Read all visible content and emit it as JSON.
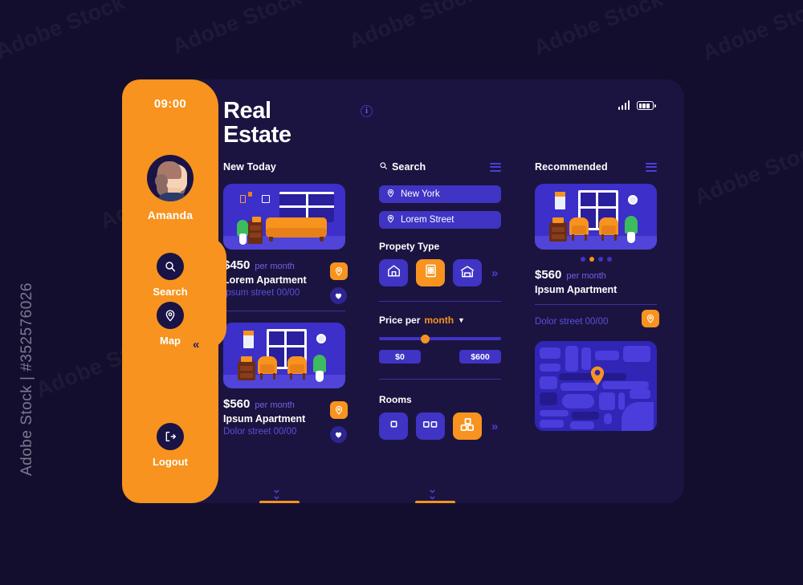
{
  "watermark": {
    "tiles": [
      "Adobe Stock",
      "Adobe Stock",
      "Adobe Stock",
      "Adobe Stock",
      "Adobe Stock",
      "Adobe Stock",
      "Adobe Stock",
      "Adobe Stock",
      "Adobe Stock",
      "Adobe Stock",
      "Adobe Stock",
      "Adobe Stock"
    ],
    "credit": "Adobe Stock | #352576026"
  },
  "colors": {
    "background": "#130e2e",
    "panel": "#1b1440",
    "accent_orange": "#f7931e",
    "accent_blue": "#3f34c4",
    "muted_blue": "#5b4fdd",
    "text": "#ffffff"
  },
  "sidebar": {
    "time": "09:00",
    "user_name": "Amanda",
    "items": [
      {
        "label": "Search",
        "icon": "search-icon"
      },
      {
        "label": "Map",
        "icon": "map-pin-icon"
      },
      {
        "label": "Logout",
        "icon": "logout-icon"
      }
    ],
    "collapse_icon": "«"
  },
  "header": {
    "title_line1": "Real",
    "title_line2": "Estate",
    "info_icon": "i",
    "signal_icon": "signal-bars-icon",
    "battery_icon": "battery-icon"
  },
  "new_today": {
    "heading": "New Today",
    "listings": [
      {
        "price": "$450",
        "period": "per month",
        "name": "Lorem Apartment",
        "address": "Ipsum street 00/00",
        "pin_icon": "map-pin-icon",
        "favorite_icon": "heart-icon",
        "illustration": "living-room-sofa"
      },
      {
        "price": "$560",
        "period": "per month",
        "name": "Ipsum Apartment",
        "address": "Dolor street 00/00",
        "pin_icon": "map-pin-icon",
        "favorite_icon": "heart-icon",
        "illustration": "living-room-armchairs"
      }
    ],
    "scroll_icon": "chevron-double-down-icon"
  },
  "search": {
    "heading": "Search",
    "search_icon": "search-icon",
    "menu_icon": "hamburger-icon",
    "fields": [
      {
        "name": "city",
        "value": "New York",
        "placeholder": "New York",
        "icon": "map-pin-icon"
      },
      {
        "name": "street",
        "value": "Lorem Street",
        "placeholder": "Lorem Street",
        "icon": "map-pin-icon"
      }
    ],
    "property_type": {
      "label": "Propety Type",
      "options": [
        {
          "name": "house",
          "icon": "house-icon",
          "selected": false
        },
        {
          "name": "apartment-block",
          "icon": "building-grid-icon",
          "selected": true
        },
        {
          "name": "villa",
          "icon": "villa-icon",
          "selected": false
        }
      ],
      "more_icon": "chevron-double-right-icon"
    },
    "price": {
      "label_static": "Price per",
      "label_value": "month",
      "dropdown_icon": "chevron-down-icon",
      "min": "$0",
      "max": "$600",
      "slider_position_percent": 36
    },
    "rooms": {
      "label": "Rooms",
      "options": [
        {
          "name": "one-room",
          "icon": "single-square-icon",
          "selected": false
        },
        {
          "name": "two-rooms",
          "icon": "double-square-icon",
          "selected": false
        },
        {
          "name": "three-rooms",
          "icon": "triple-square-icon",
          "selected": true
        }
      ],
      "more_icon": "chevron-double-right-icon"
    },
    "scroll_icon": "chevron-double-down-icon"
  },
  "recommended": {
    "heading": "Recommended",
    "menu_icon": "hamburger-icon",
    "listing": {
      "price": "$560",
      "period": "per month",
      "name": "Ipsum Apartment",
      "address": "Dolor street 00/00",
      "pin_icon": "map-pin-icon",
      "illustration": "living-room-armchairs"
    },
    "carousel": {
      "total": 4,
      "active_index": 1
    },
    "map": {
      "pin_icon": "map-pin-icon"
    }
  }
}
